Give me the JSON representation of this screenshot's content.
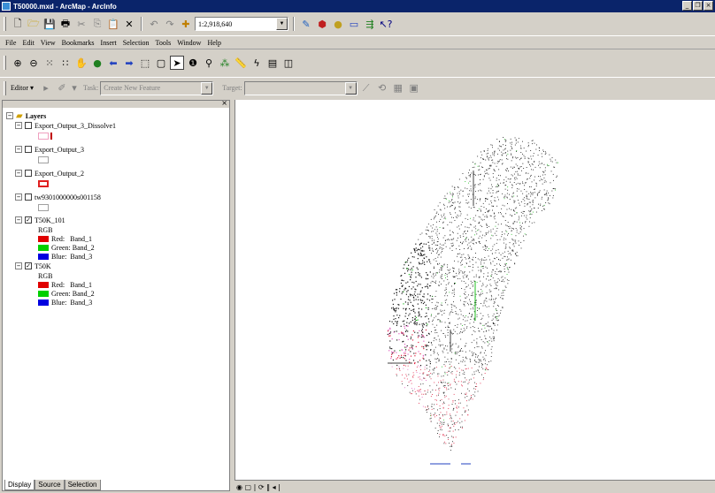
{
  "window": {
    "title": "T50000.mxd - ArcMap - ArcInfo"
  },
  "standard_toolbar": {
    "scale_value": "1:2,918,640"
  },
  "menu": {
    "items": [
      "File",
      "Edit",
      "View",
      "Bookmarks",
      "Insert",
      "Selection",
      "Tools",
      "Window",
      "Help"
    ]
  },
  "editor_toolbar": {
    "editor_label": "Editor ▾",
    "task_label": "Task:",
    "task_value": "Create New Feature",
    "target_label": "Target:",
    "target_value": ""
  },
  "toc": {
    "root_label": "Layers",
    "layers": [
      {
        "name": "Export_Output_3_Dissolve1",
        "checked": false,
        "swatch_border": "#f0a0c0"
      },
      {
        "name": "Export_Output_3",
        "checked": false,
        "swatch_border": "#a0a0a0"
      },
      {
        "name": "Export_Output_2",
        "checked": false,
        "swatch_border": "#e02020"
      },
      {
        "name": "tw9301000000s001158",
        "checked": false,
        "swatch_border": "#a0a0a0"
      },
      {
        "name": "T50K_101",
        "checked": true,
        "rgb_label": "RGB",
        "bands": [
          {
            "label": "Red:   Band_1",
            "color": "#e00000"
          },
          {
            "label": "Green: Band_2",
            "color": "#00d000"
          },
          {
            "label": "Blue:  Band_3",
            "color": "#0000e0"
          }
        ]
      },
      {
        "name": "T50K",
        "checked": true,
        "rgb_label": "RGB",
        "bands": [
          {
            "label": "Red:   Band_1",
            "color": "#e00000"
          },
          {
            "label": "Green: Band_2",
            "color": "#00d000"
          },
          {
            "label": "Blue:  Band_3",
            "color": "#0000e0"
          }
        ]
      }
    ],
    "tabs": [
      "Display",
      "Source",
      "Selection"
    ]
  },
  "colors": {
    "titlebar": "#0a246a",
    "chrome": "#d4d0c8",
    "map_points_dark": "#1a1a1a",
    "map_points_red": "#e02040",
    "map_points_pink": "#e060c0",
    "map_points_green": "#20c020"
  },
  "status": {
    "glyphs": "◉ ▢ | ⟳ ‖ ◂ |"
  }
}
